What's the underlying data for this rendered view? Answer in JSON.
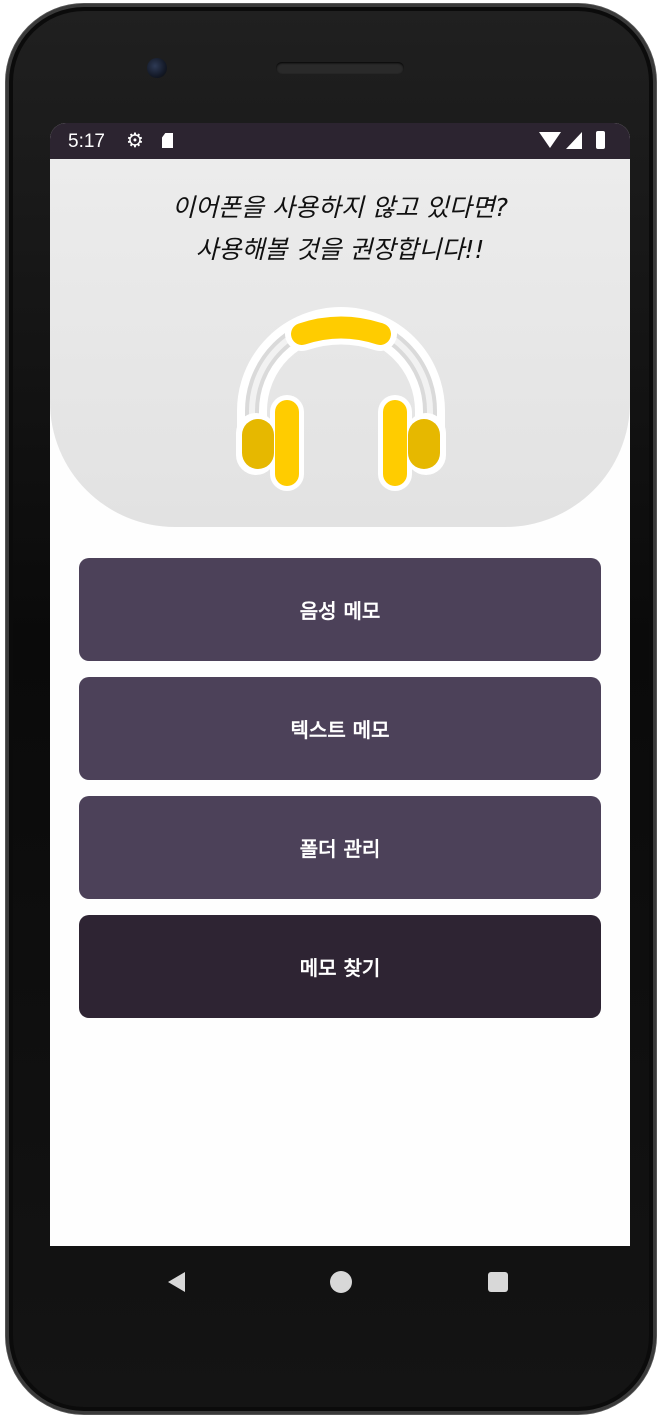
{
  "status_bar": {
    "time": "5:17",
    "icons": [
      "settings-icon",
      "sd-card-icon",
      "wifi-icon",
      "signal-icon",
      "battery-icon"
    ]
  },
  "header": {
    "line1": "이어폰을 사용하지 않고 있다면?",
    "line2": "사용해볼 것을 권장합니다!!",
    "illustration": "headphones-icon",
    "accent_color": "#FFCC00"
  },
  "menu": {
    "voice_memo": "음성 메모",
    "text_memo": "텍스트 메모",
    "folder_manage": "폴더 관리",
    "find_memo": "메모 찾기"
  },
  "colors": {
    "status_bar": "#2C2430",
    "button": "#4C4159",
    "button_dark": "#2E2433",
    "header_bg": "#E6E6E6"
  },
  "nav_bar": {
    "icons": [
      "back-icon",
      "home-icon",
      "recents-icon"
    ]
  }
}
